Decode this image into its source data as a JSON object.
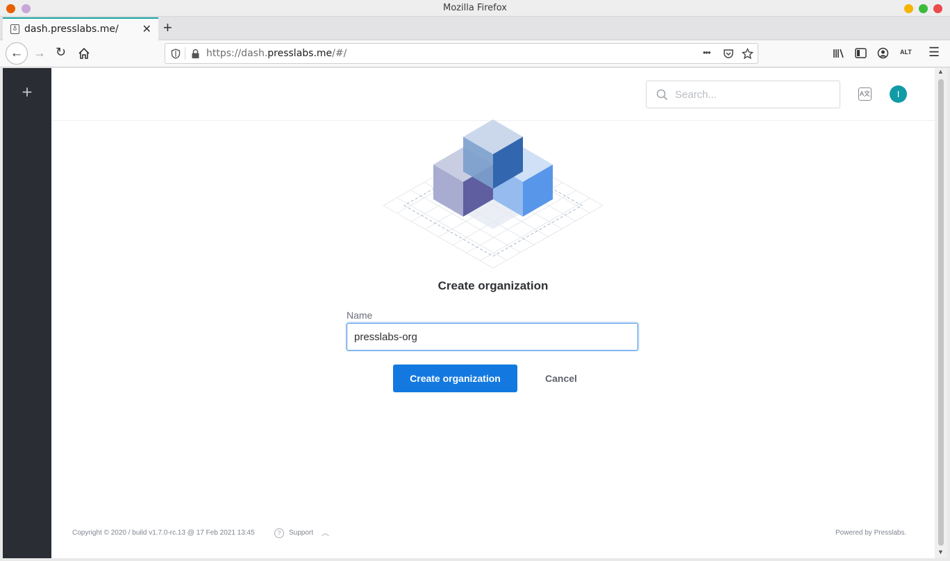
{
  "window": {
    "title": "Mozilla Firefox"
  },
  "tab": {
    "label": "dash.presslabs.me/",
    "close": "✕"
  },
  "newtab": {
    "label": "+"
  },
  "urlbar": {
    "prefix": "https://dash.",
    "domain": "presslabs.me",
    "suffix": "/#/",
    "more": "•••"
  },
  "sidebar": {
    "add": "+"
  },
  "header": {
    "search_placeholder": "Search...",
    "avatar_letter": "I"
  },
  "form": {
    "title": "Create organization",
    "name_label": "Name",
    "name_value": "presslabs-org",
    "create_label": "Create organization",
    "cancel_label": "Cancel"
  },
  "footer": {
    "copyright": "Copyright © 2020 / build v1.7.0-rc.13 @ 17 Feb 2021 13:45",
    "support": "Support",
    "powered": "Powered by Presslabs."
  },
  "colors": {
    "primary": "#1379e0",
    "avatar": "#119ba6",
    "sidebar": "#2a2e34",
    "tab_accent": "#14a3a3"
  }
}
